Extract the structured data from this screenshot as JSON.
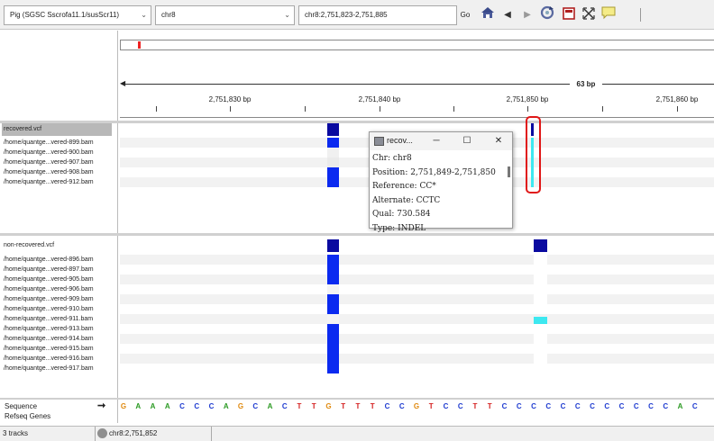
{
  "toolbar": {
    "genome": "Pig (SGSC Sscrofa11.1/susScr11)",
    "chromosome": "chr8",
    "locus": "chr8:2,751,823-2,751,885",
    "go_label": "Go"
  },
  "ruler": {
    "span": "63 bp",
    "ticks": [
      "2,751,830 bp",
      "2,751,840 bp",
      "2,751,850 bp",
      "2,751,860 bp"
    ]
  },
  "panel1": {
    "vcf_name": "recovered.vcf",
    "bams": [
      "/home/quantge...vered-899.bam",
      "/home/quantge...vered-900.bam",
      "/home/quantge...vered-907.bam",
      "/home/quantge...vered-908.bam",
      "/home/quantge...vered-912.bam"
    ]
  },
  "panel2": {
    "vcf_name": "non-recovered.vcf",
    "bams": [
      "/home/quantge...vered-896.bam",
      "/home/quantge...vered-897.bam",
      "/home/quantge...vered-905.bam",
      "/home/quantge...vered-906.bam",
      "/home/quantge...vered-909.bam",
      "/home/quantge...vered-910.bam",
      "/home/quantge...vered-911.bam",
      "/home/quantge...vered-913.bam",
      "/home/quantge...vered-914.bam",
      "/home/quantge...vered-915.bam",
      "/home/quantge...vered-916.bam",
      "/home/quantge...vered-917.bam"
    ]
  },
  "popup": {
    "title": "recov...",
    "chr": "Chr: chr8",
    "position": "Position: 2,751,849-2,751,850",
    "reference": "Reference: CC*",
    "alternate": "Alternate: CCTC",
    "qual": "Qual: 730.584",
    "type": "Type: INDEL"
  },
  "sequence": {
    "label": "Sequence",
    "refseq_label": "Refseq Genes",
    "arrow": "➞",
    "bases": [
      "G",
      "A",
      "A",
      "A",
      "C",
      "C",
      "C",
      "A",
      "G",
      "C",
      "A",
      "C",
      "T",
      "T",
      "G",
      "T",
      "T",
      "T",
      "C",
      "C",
      "G",
      "T",
      "C",
      "C",
      "T",
      "T",
      "C",
      "C",
      "C",
      "C",
      "C",
      "C",
      "C",
      "C",
      "C",
      "C",
      "C",
      "C",
      "A",
      "C"
    ]
  },
  "status": {
    "tracks": "3 tracks",
    "locus": "chr8:2,751,852"
  },
  "colors": {
    "hom_var": "#0b10c8",
    "het": "#0b2af0",
    "vcf_site": "#0a0aa0",
    "hom_ref": "#3de8f0",
    "base_A": "#2a9a22",
    "base_C": "#1f3cd0",
    "base_G": "#e08a10",
    "base_T": "#d42020"
  }
}
